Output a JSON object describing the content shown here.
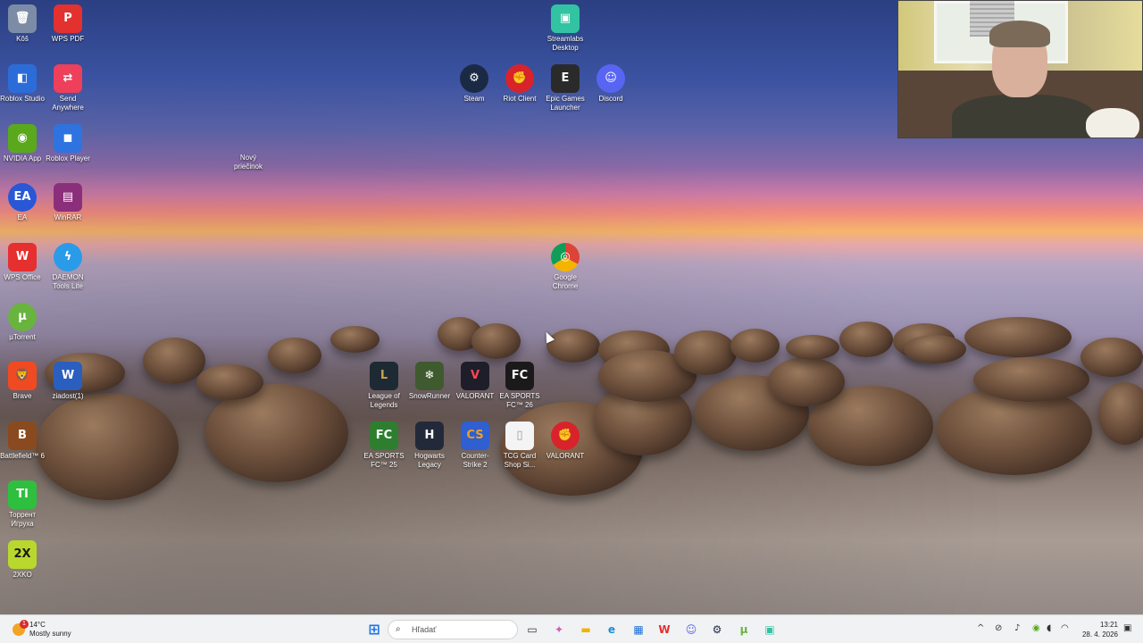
{
  "desktop": {
    "icons": [
      {
        "label": "Kôš",
        "glyph": "🗑",
        "color": "#7c8ca6"
      },
      {
        "label": "WPS PDF",
        "glyph": "P",
        "color": "#e2312f"
      },
      {
        "label": "Roblox Studio",
        "glyph": "◧",
        "color": "#2b6cd8"
      },
      {
        "label": "Send Anywhere",
        "glyph": "⇄",
        "color": "#ee3f5b"
      },
      {
        "label": "NVIDIA App",
        "glyph": "◉",
        "color": "#5aa91d"
      },
      {
        "label": "Roblox Player",
        "glyph": "◼",
        "color": "#2f73e0"
      },
      {
        "label": "Nový priečinok",
        "glyph": "",
        "color": "transparent"
      },
      {
        "label": "EA",
        "glyph": "EA",
        "color": "#2957d6"
      },
      {
        "label": "WinRAR",
        "glyph": "▤",
        "color": "#8c2f7a"
      },
      {
        "label": "WPS Office",
        "glyph": "W",
        "color": "#e62f2f"
      },
      {
        "label": "DAEMON Tools Lite",
        "glyph": "ϟ",
        "color": "#2a9be8"
      },
      {
        "label": "µTorrent",
        "glyph": "µ",
        "color": "#68b43e"
      },
      {
        "label": "Brave",
        "glyph": "🦁",
        "color": "#f04a22"
      },
      {
        "label": "ziadost(1)",
        "glyph": "W",
        "color": "#2a5fbf"
      },
      {
        "label": "Battlefield™ 6",
        "glyph": "B",
        "color": "#8a4a1f"
      },
      {
        "label": "Торрент Игруха",
        "glyph": "TI",
        "color": "#2fbf3f"
      },
      {
        "label": "2XKO",
        "glyph": "2X",
        "color": "#b9d82d"
      },
      {
        "label": "Streamlabs Desktop",
        "glyph": "▣",
        "color": "#31c3a2"
      },
      {
        "label": "Steam",
        "glyph": "⚙",
        "color": "#1b2a44"
      },
      {
        "label": "Riot Client",
        "glyph": "✊",
        "color": "#d8232b"
      },
      {
        "label": "Epic Games Launcher",
        "glyph": "E",
        "color": "#2a2a2a"
      },
      {
        "label": "Discord",
        "glyph": "☺",
        "color": "#5865f2"
      },
      {
        "label": "Google Chrome",
        "glyph": "◎",
        "color": "#2f8f3f"
      },
      {
        "label": "League of Legends",
        "glyph": "L",
        "color": "#1d2a33"
      },
      {
        "label": "SnowRunner",
        "glyph": "❄",
        "color": "#3f5a2f"
      },
      {
        "label": "VALORANT",
        "glyph": "V",
        "color": "#1e1e2a"
      },
      {
        "label": "EA SPORTS FC™ 26",
        "glyph": "FC",
        "color": "#1a1a1a"
      },
      {
        "label": "EA SPORTS FC™ 25",
        "glyph": "FC",
        "color": "#2d7f2f"
      },
      {
        "label": "Hogwarts Legacy",
        "glyph": "H",
        "color": "#222a3a"
      },
      {
        "label": "Counter-Strike 2",
        "glyph": "CS",
        "color": "#2f5fd0"
      },
      {
        "label": "TCG Card Shop Si...",
        "glyph": "▯",
        "color": "#f4f4f4"
      },
      {
        "label": "VALORANT",
        "glyph": "✊",
        "color": "#d8232b"
      }
    ]
  },
  "taskbar": {
    "weather": {
      "badge": "1",
      "temp": "14°C",
      "condition": "Mostly sunny"
    },
    "start_glyph": "⊞",
    "search_placeholder": "Hľadať",
    "pinned": [
      {
        "name": "task-view",
        "glyph": "▭",
        "color": "#333"
      },
      {
        "name": "copilot",
        "glyph": "✦",
        "color": "#ce5db7"
      },
      {
        "name": "file-explorer",
        "glyph": "▬",
        "color": "#f0b400"
      },
      {
        "name": "edge",
        "glyph": "e",
        "color": "#1c8fd4"
      },
      {
        "name": "microsoft-store",
        "glyph": "▦",
        "color": "#1c6fd4"
      },
      {
        "name": "wps-office",
        "glyph": "W",
        "color": "#e62f2f"
      },
      {
        "name": "discord",
        "glyph": "☺",
        "color": "#5865f2"
      },
      {
        "name": "steam",
        "glyph": "⚙",
        "color": "#1b2a44"
      },
      {
        "name": "utorrent",
        "glyph": "µ",
        "color": "#68b43e"
      },
      {
        "name": "streamlabs",
        "glyph": "▣",
        "color": "#31c3a2"
      }
    ],
    "tray": {
      "chevron": "^",
      "time": "13:21",
      "date": "28. 4. 2026"
    }
  }
}
